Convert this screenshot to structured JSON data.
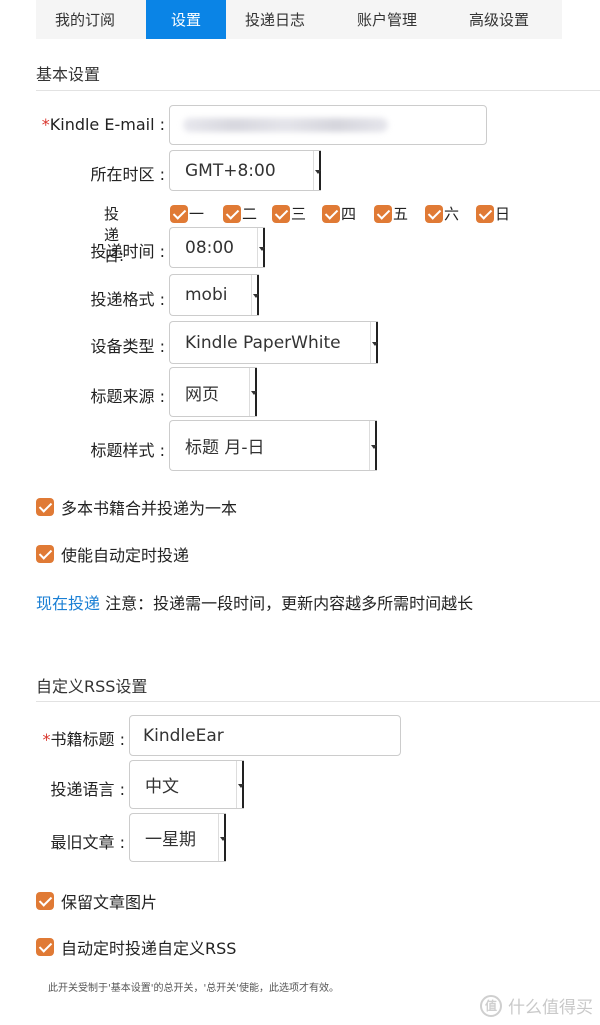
{
  "tabs": [
    {
      "label": "我的订阅",
      "active": false
    },
    {
      "label": "设置",
      "active": true
    },
    {
      "label": "投递日志",
      "active": false
    },
    {
      "label": "账户管理",
      "active": false
    },
    {
      "label": "高级设置",
      "active": false
    }
  ],
  "colors": {
    "accent": "#0a84e6",
    "checkbox": "#e07a35",
    "required": "#d9342b",
    "link": "#1a7fd4"
  },
  "basic": {
    "title": "基本设置",
    "kindle_email": {
      "required_mark": "*",
      "label": "Kindle E-mail :",
      "value": ""
    },
    "timezone": {
      "label": "所在时区 :",
      "value": "GMT+8:00"
    },
    "delivery_days": {
      "label": "投递日:",
      "days": [
        "一",
        "二",
        "三",
        "四",
        "五",
        "六",
        "日"
      ]
    },
    "delivery_time": {
      "label": "投递时间 :",
      "value": "08:00"
    },
    "delivery_format": {
      "label": "投递格式 :",
      "value": "mobi"
    },
    "device_type": {
      "label": "设备类型 :",
      "value": "Kindle PaperWhite"
    },
    "title_source": {
      "label": "标题来源 :",
      "value": "网页"
    },
    "title_style": {
      "label": "标题样式 :",
      "value": "标题 月-日"
    },
    "merge_books": {
      "label": "多本书籍合并投递为一本",
      "checked": true
    },
    "auto_delivery": {
      "label": "使能自动定时投递",
      "checked": true
    },
    "deliver_now": "现在投递",
    "notice": " 注意：投递需一段时间，更新内容越多所需时间越长"
  },
  "rss": {
    "title": "自定义RSS设置",
    "book_title": {
      "required_mark": "*",
      "label": "书籍标题 :",
      "value": "KindleEar"
    },
    "language": {
      "label": "投递语言 :",
      "value": "中文"
    },
    "oldest_article": {
      "label": "最旧文章 :",
      "value": "一星期"
    },
    "keep_images": {
      "label": "保留文章图片",
      "checked": true
    },
    "auto_rss": {
      "label": "自动定时投递自定义RSS",
      "checked": true
    },
    "footnote": "此开关受制于'基本设置'的总开关，'总开关'使能，此选项才有效。"
  },
  "watermark": {
    "logo_text": "值",
    "text": "什么值得买"
  }
}
